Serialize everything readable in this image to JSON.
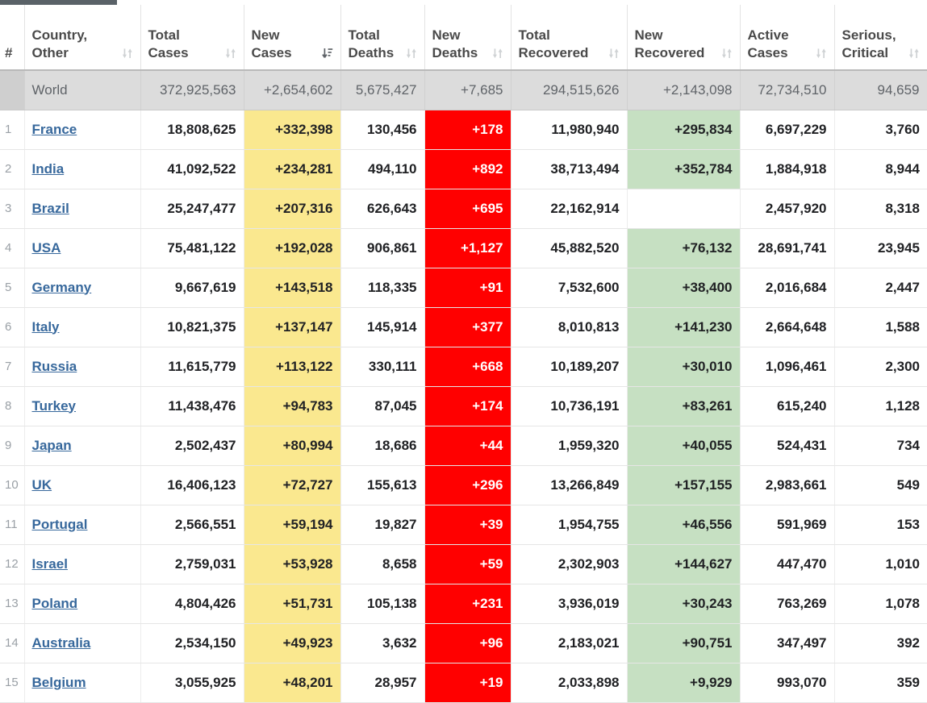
{
  "table": {
    "columns": [
      {
        "label": "#",
        "sort": "none",
        "align": "left"
      },
      {
        "label": "Country,\nOther",
        "sort": "inactive",
        "align": "left"
      },
      {
        "label": "Total\nCases",
        "sort": "inactive",
        "align": "left"
      },
      {
        "label": "New\nCases",
        "sort": "desc-active",
        "align": "left"
      },
      {
        "label": "Total\nDeaths",
        "sort": "inactive",
        "align": "left"
      },
      {
        "label": "New\nDeaths",
        "sort": "inactive",
        "align": "left"
      },
      {
        "label": "Total\nRecovered",
        "sort": "inactive",
        "align": "left"
      },
      {
        "label": "New\nRecovered",
        "sort": "inactive",
        "align": "left"
      },
      {
        "label": "Active\nCases",
        "sort": "inactive",
        "align": "left"
      },
      {
        "label": "Serious,\nCritical",
        "sort": "inactive",
        "align": "left"
      }
    ],
    "world_row": {
      "num": "",
      "country": "World",
      "total_cases": "372,925,563",
      "new_cases": "+2,654,602",
      "total_deaths": "5,675,427",
      "new_deaths": "+7,685",
      "total_recovered": "294,515,626",
      "new_recovered": "+2,143,098",
      "active_cases": "72,734,510",
      "serious_critical": "94,659"
    },
    "rows": [
      {
        "num": "1",
        "country": "France",
        "total_cases": "18,808,625",
        "new_cases": "+332,398",
        "total_deaths": "130,456",
        "new_deaths": "+178",
        "total_recovered": "11,980,940",
        "new_recovered": "+295,834",
        "active_cases": "6,697,229",
        "serious_critical": "3,760"
      },
      {
        "num": "2",
        "country": "India",
        "total_cases": "41,092,522",
        "new_cases": "+234,281",
        "total_deaths": "494,110",
        "new_deaths": "+892",
        "total_recovered": "38,713,494",
        "new_recovered": "+352,784",
        "active_cases": "1,884,918",
        "serious_critical": "8,944"
      },
      {
        "num": "3",
        "country": "Brazil",
        "total_cases": "25,247,477",
        "new_cases": "+207,316",
        "total_deaths": "626,643",
        "new_deaths": "+695",
        "total_recovered": "22,162,914",
        "new_recovered": "",
        "active_cases": "2,457,920",
        "serious_critical": "8,318"
      },
      {
        "num": "4",
        "country": "USA",
        "total_cases": "75,481,122",
        "new_cases": "+192,028",
        "total_deaths": "906,861",
        "new_deaths": "+1,127",
        "total_recovered": "45,882,520",
        "new_recovered": "+76,132",
        "active_cases": "28,691,741",
        "serious_critical": "23,945"
      },
      {
        "num": "5",
        "country": "Germany",
        "total_cases": "9,667,619",
        "new_cases": "+143,518",
        "total_deaths": "118,335",
        "new_deaths": "+91",
        "total_recovered": "7,532,600",
        "new_recovered": "+38,400",
        "active_cases": "2,016,684",
        "serious_critical": "2,447"
      },
      {
        "num": "6",
        "country": "Italy",
        "total_cases": "10,821,375",
        "new_cases": "+137,147",
        "total_deaths": "145,914",
        "new_deaths": "+377",
        "total_recovered": "8,010,813",
        "new_recovered": "+141,230",
        "active_cases": "2,664,648",
        "serious_critical": "1,588"
      },
      {
        "num": "7",
        "country": "Russia",
        "total_cases": "11,615,779",
        "new_cases": "+113,122",
        "total_deaths": "330,111",
        "new_deaths": "+668",
        "total_recovered": "10,189,207",
        "new_recovered": "+30,010",
        "active_cases": "1,096,461",
        "serious_critical": "2,300"
      },
      {
        "num": "8",
        "country": "Turkey",
        "total_cases": "11,438,476",
        "new_cases": "+94,783",
        "total_deaths": "87,045",
        "new_deaths": "+174",
        "total_recovered": "10,736,191",
        "new_recovered": "+83,261",
        "active_cases": "615,240",
        "serious_critical": "1,128"
      },
      {
        "num": "9",
        "country": "Japan",
        "total_cases": "2,502,437",
        "new_cases": "+80,994",
        "total_deaths": "18,686",
        "new_deaths": "+44",
        "total_recovered": "1,959,320",
        "new_recovered": "+40,055",
        "active_cases": "524,431",
        "serious_critical": "734"
      },
      {
        "num": "10",
        "country": "UK",
        "total_cases": "16,406,123",
        "new_cases": "+72,727",
        "total_deaths": "155,613",
        "new_deaths": "+296",
        "total_recovered": "13,266,849",
        "new_recovered": "+157,155",
        "active_cases": "2,983,661",
        "serious_critical": "549"
      },
      {
        "num": "11",
        "country": "Portugal",
        "total_cases": "2,566,551",
        "new_cases": "+59,194",
        "total_deaths": "19,827",
        "new_deaths": "+39",
        "total_recovered": "1,954,755",
        "new_recovered": "+46,556",
        "active_cases": "591,969",
        "serious_critical": "153"
      },
      {
        "num": "12",
        "country": "Israel",
        "total_cases": "2,759,031",
        "new_cases": "+53,928",
        "total_deaths": "8,658",
        "new_deaths": "+59",
        "total_recovered": "2,302,903",
        "new_recovered": "+144,627",
        "active_cases": "447,470",
        "serious_critical": "1,010"
      },
      {
        "num": "13",
        "country": "Poland",
        "total_cases": "4,804,426",
        "new_cases": "+51,731",
        "total_deaths": "105,138",
        "new_deaths": "+231",
        "total_recovered": "3,936,019",
        "new_recovered": "+30,243",
        "active_cases": "763,269",
        "serious_critical": "1,078"
      },
      {
        "num": "14",
        "country": "Australia",
        "total_cases": "2,534,150",
        "new_cases": "+49,923",
        "total_deaths": "3,632",
        "new_deaths": "+96",
        "total_recovered": "2,183,021",
        "new_recovered": "+90,751",
        "active_cases": "347,497",
        "serious_critical": "392"
      },
      {
        "num": "15",
        "country": "Belgium",
        "total_cases": "3,055,925",
        "new_cases": "+48,201",
        "total_deaths": "28,957",
        "new_deaths": "+19",
        "total_recovered": "2,033,898",
        "new_recovered": "+9,929",
        "active_cases": "993,070",
        "serious_critical": "359"
      }
    ]
  },
  "colors": {
    "new_cases_highlight": "#fae88f",
    "new_deaths_highlight": "#ff0000",
    "new_recovered_highlight": "#c6e0c2",
    "world_row_background": "#dcdcdc",
    "link": "#37689c",
    "top_strip": "#5a6268"
  }
}
